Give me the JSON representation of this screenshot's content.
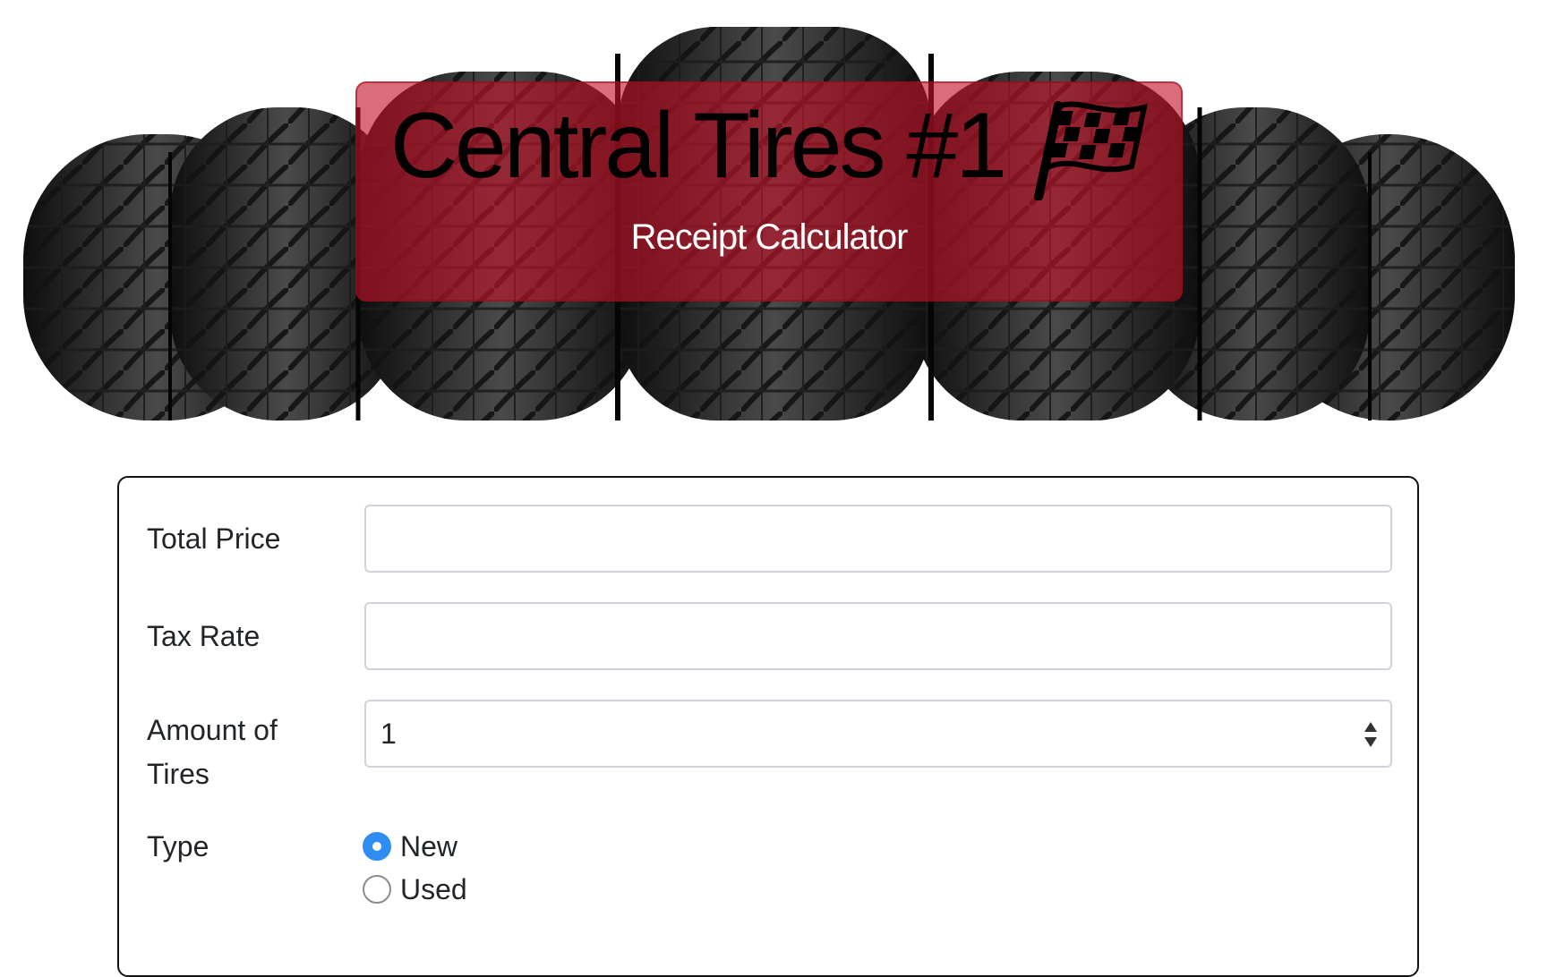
{
  "hero": {
    "title": "Central Tires #1",
    "subtitle": "Receipt Calculator",
    "title_icon": "checkered-flag-icon",
    "overlay_color": "#c41426",
    "background_image": "tire-row"
  },
  "form": {
    "fields": [
      {
        "label": "Total Price",
        "value": "",
        "placeholder": ""
      },
      {
        "label": "Tax Rate",
        "value": "",
        "placeholder": ""
      },
      {
        "label_line1": "Amount of",
        "label_line2": "Tires",
        "value": "1"
      }
    ],
    "type": {
      "label": "Type",
      "options": [
        {
          "label": "New",
          "checked": true
        },
        {
          "label": "Used",
          "checked": false
        }
      ]
    }
  },
  "colors": {
    "accent": "#2f8cf3",
    "input_border": "#ced4da",
    "card_border": "#111111"
  }
}
